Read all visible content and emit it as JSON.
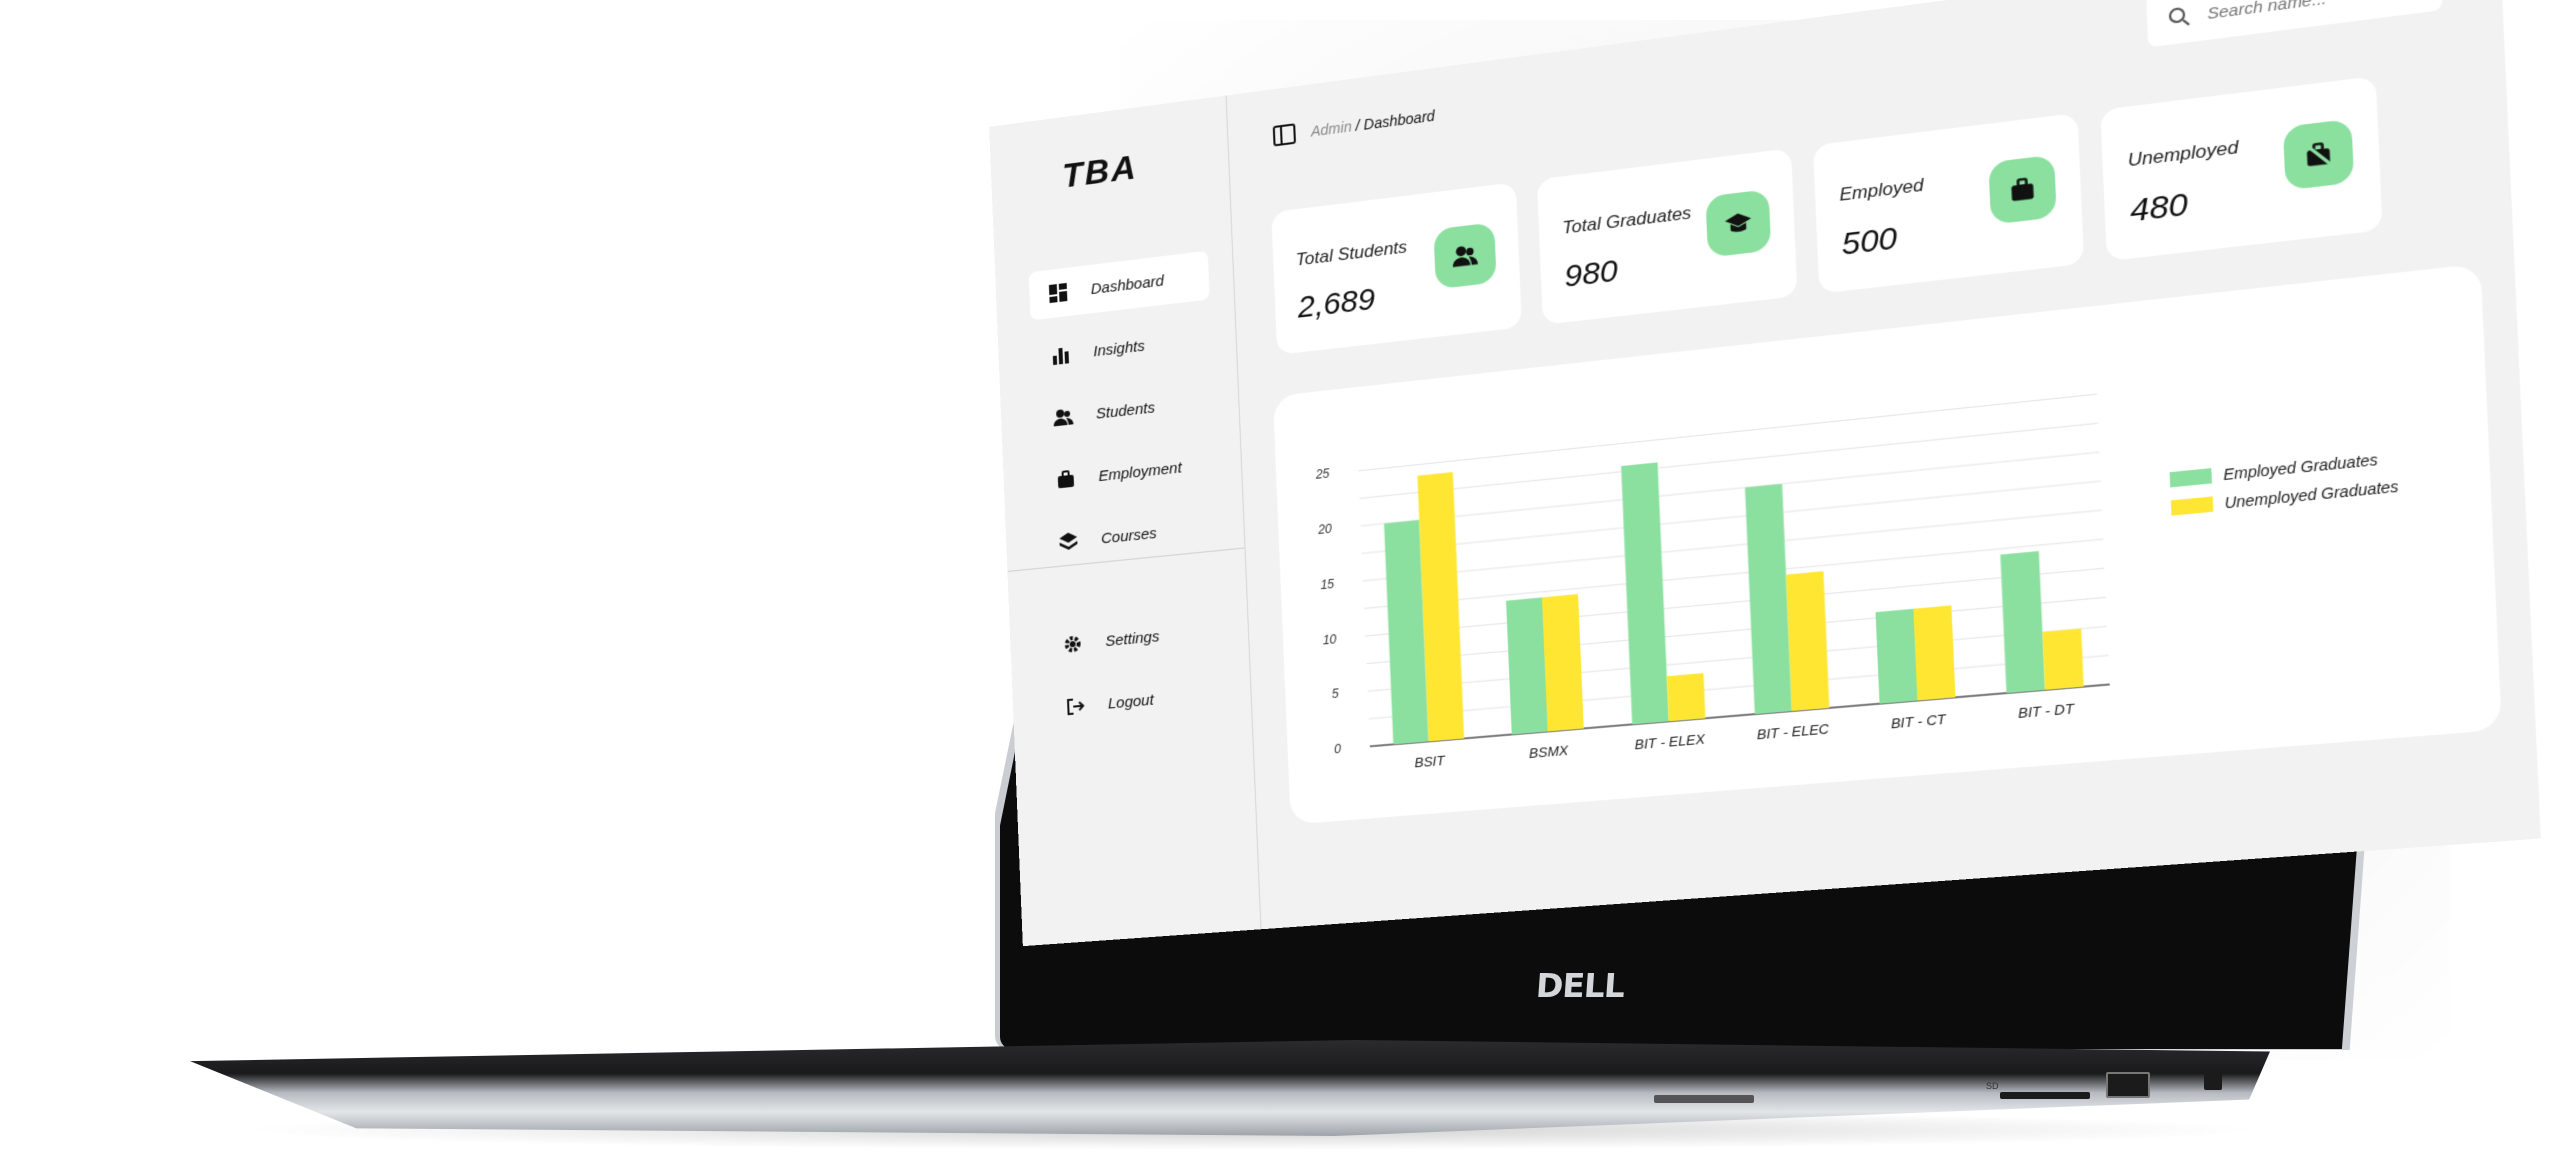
{
  "sidebar": {
    "logo": "TBA",
    "items": [
      {
        "label": "Dashboard",
        "icon": "dashboard-icon",
        "active": true
      },
      {
        "label": "Insights",
        "icon": "bar-chart-icon"
      },
      {
        "label": "Students",
        "icon": "users-icon"
      },
      {
        "label": "Employment",
        "icon": "briefcase-icon"
      },
      {
        "label": "Courses",
        "icon": "layers-icon"
      }
    ],
    "bottom_items": [
      {
        "label": "Settings",
        "icon": "gear-icon"
      },
      {
        "label": "Logout",
        "icon": "logout-icon"
      }
    ]
  },
  "breadcrumb": {
    "parent": "Admin",
    "separator": " / ",
    "current": "Dashboard"
  },
  "search": {
    "placeholder": "Search name..."
  },
  "cards": [
    {
      "label": "Total Students",
      "value": "2,689",
      "icon": "users-icon"
    },
    {
      "label": "Total Graduates",
      "value": "980",
      "icon": "graduation-cap-icon"
    },
    {
      "label": "Employed",
      "value": "500",
      "icon": "briefcase-icon"
    },
    {
      "label": "Unemployed",
      "value": "480",
      "icon": "briefcase-off-icon"
    }
  ],
  "colors": {
    "accent": "#8be0a0",
    "employed": "#8be0a0",
    "unemployed": "#ffe633"
  },
  "laptop": {
    "brand": "DELL",
    "port_label": "SD"
  },
  "chart_data": {
    "type": "bar",
    "categories": [
      "BSIT",
      "BSMX",
      "BIT - ELEX",
      "BIT - ELEC",
      "BIT - CT",
      "BIT - DT"
    ],
    "series": [
      {
        "name": "Employed Graduates",
        "values": [
          20,
          12,
          23,
          20,
          8,
          12
        ]
      },
      {
        "name": "Unemployed Graduates",
        "values": [
          24,
          12,
          4,
          12,
          8,
          5
        ]
      }
    ],
    "yticks": [
      0,
      5,
      10,
      15,
      20,
      25
    ],
    "ylim": [
      0,
      27
    ],
    "grid": true,
    "legend": "right"
  }
}
